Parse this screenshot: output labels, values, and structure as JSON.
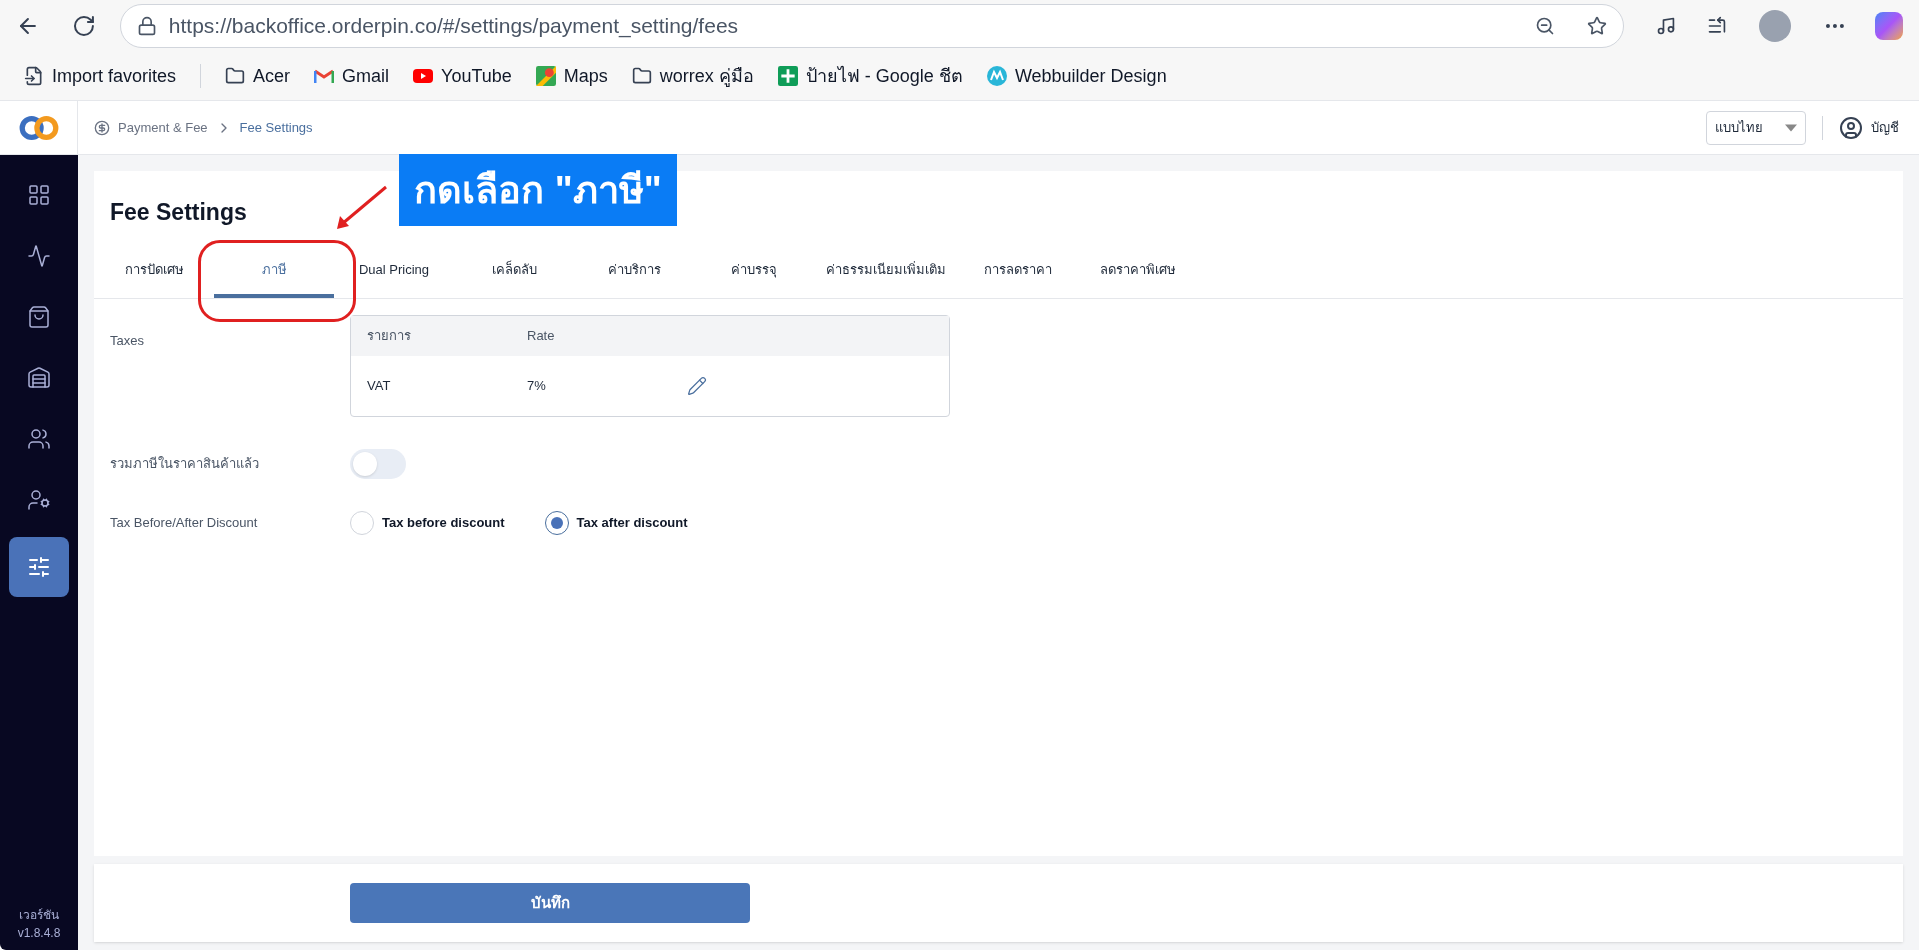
{
  "browser": {
    "url": "https://backoffice.orderpin.co/#/settings/payment_setting/fees",
    "bookmarks": [
      {
        "kind": "import",
        "label": "Import favorites"
      },
      {
        "kind": "folder",
        "label": "Acer"
      },
      {
        "kind": "gmail",
        "label": "Gmail"
      },
      {
        "kind": "youtube",
        "label": "YouTube"
      },
      {
        "kind": "maps",
        "label": "Maps"
      },
      {
        "kind": "folder",
        "label": "worrex คู่มือ"
      },
      {
        "kind": "sheets",
        "label": "ป้ายไฟ - Google ชีต"
      },
      {
        "kind": "webbuilder",
        "label": "Webbuilder Design"
      }
    ]
  },
  "header": {
    "breadcrumb": [
      "Payment & Fee",
      "Fee Settings"
    ],
    "language": "แบบไทย",
    "account": "บัญชี"
  },
  "sidebar": {
    "items": [
      {
        "kind": "grid",
        "selected": false
      },
      {
        "kind": "activity",
        "selected": false
      },
      {
        "kind": "bag",
        "selected": false
      },
      {
        "kind": "store",
        "selected": false
      },
      {
        "kind": "users",
        "selected": false
      },
      {
        "kind": "user-settings",
        "selected": false
      },
      {
        "kind": "sliders",
        "selected": true
      }
    ],
    "version_label": "เวอร์ชัน",
    "version": "v1.8.4.8"
  },
  "page": {
    "title": "Fee Settings",
    "tabs": [
      {
        "label": "การปัดเศษ",
        "selected": false
      },
      {
        "label": "ภาษี",
        "selected": true
      },
      {
        "label": "Dual Pricing",
        "selected": false
      },
      {
        "label": "เคล็ดลับ",
        "selected": false
      },
      {
        "label": "ค่าบริการ",
        "selected": false
      },
      {
        "label": "ค่าบรรจุ",
        "selected": false
      },
      {
        "label": "ค่าธรรมเนียมเพิ่มเติม",
        "selected": false
      },
      {
        "label": "การลดราคา",
        "selected": false
      },
      {
        "label": "ลดราคาพิเศษ",
        "selected": false
      }
    ],
    "taxes": {
      "label": "Taxes",
      "columns": [
        "รายการ",
        "Rate"
      ],
      "rows": [
        {
          "name": "VAT",
          "rate": "7%"
        }
      ]
    },
    "include_tax": {
      "label": "รวมภาษีในราคาสินค้าแล้ว",
      "on": false
    },
    "tax_discount": {
      "label": "Tax Before/After Discount",
      "options": [
        {
          "label": "Tax before discount",
          "selected": false
        },
        {
          "label": "Tax after discount",
          "selected": true
        }
      ]
    },
    "save": "บันทึก"
  },
  "annotation": {
    "text": "กดเลือก \"ภาษี\""
  }
}
